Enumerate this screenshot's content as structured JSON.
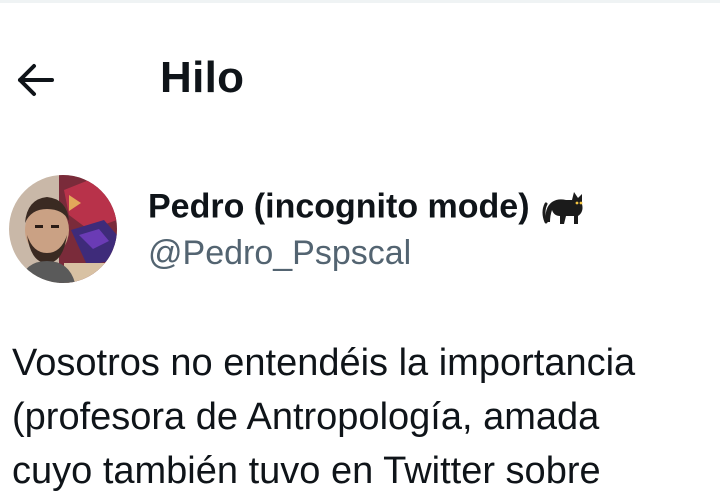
{
  "header": {
    "back_label": "",
    "title": "Hilo"
  },
  "author": {
    "display_name": "Pedro (incognito mode)",
    "badge_emoji": "black-cat-emoji",
    "handle": "@Pedro_Pspscal"
  },
  "tweet": {
    "lines": [
      "Vosotros no entendéis la importancia",
      "(profesora de Antropología, amada",
      "cuyo también tuvo en Twitter sobre"
    ]
  },
  "colors": {
    "text": "#0f1419",
    "secondary": "#536471",
    "border": "#eff3f4"
  }
}
